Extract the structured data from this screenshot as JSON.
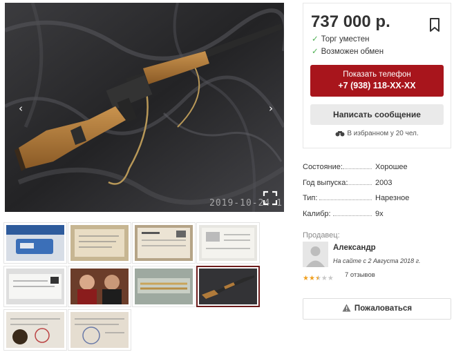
{
  "gallery": {
    "prev_arrow": "‹",
    "next_arrow": "›",
    "watermark": "2019-10-24 1"
  },
  "listing": {
    "price": "737 000 р.",
    "features": [
      "Торг уместен",
      "Возможен обмен"
    ],
    "phone_button": {
      "label": "Показать телефон",
      "phone": "+7 (938) 118-XX-XX"
    },
    "message_button": "Написать сообщение",
    "favorites": "В избранном у 20 чел."
  },
  "specs": [
    {
      "key": "Состояние:",
      "value": "Хорошее"
    },
    {
      "key": "Год выпуска:",
      "value": "2003"
    },
    {
      "key": "Тип:",
      "value": "Нарезное"
    },
    {
      "key": "Калибр:",
      "value": "9х"
    }
  ],
  "seller": {
    "label": "Продавец:",
    "name": "Александр",
    "since": "На сайте с 2 Августа 2018 г.",
    "rating": 2.5,
    "rating_max": 5,
    "reviews": "7 отзывов"
  },
  "report_button": "Пожаловаться",
  "colors": {
    "accent": "#a8151c",
    "check": "#4caf50",
    "star": "#f0a020"
  },
  "icons": [
    "chevron-left-icon",
    "chevron-right-icon",
    "fullscreen-icon",
    "bookmark-icon",
    "check-icon",
    "binoculars-icon",
    "warning-icon",
    "avatar-icon"
  ]
}
